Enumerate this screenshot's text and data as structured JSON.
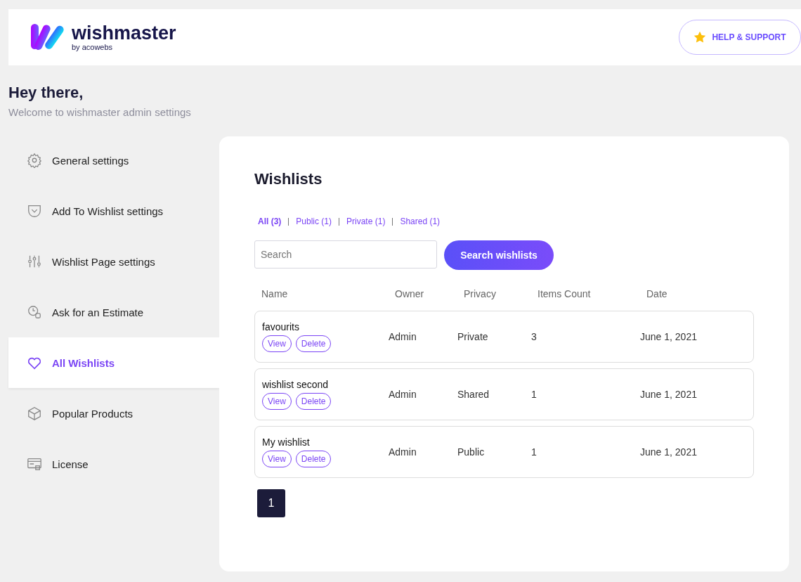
{
  "header": {
    "brand": "wishmaster",
    "byline": "by acowebs",
    "help_button": "HELP & SUPPORT"
  },
  "greeting": {
    "title": "Hey there,",
    "subtitle": "Welcome to wishmaster admin settings"
  },
  "sidebar": {
    "items": [
      {
        "label": "General settings",
        "kind": "gear",
        "selected": false
      },
      {
        "label": "Add To Wishlist settings",
        "kind": "pocket",
        "selected": false
      },
      {
        "label": "Wishlist Page settings",
        "kind": "sliders",
        "selected": false
      },
      {
        "label": "Ask for an Estimate",
        "kind": "estimate",
        "selected": false
      },
      {
        "label": "All Wishlists",
        "kind": "heart",
        "selected": true
      },
      {
        "label": "Popular Products",
        "kind": "box",
        "selected": false
      },
      {
        "label": "License",
        "kind": "license",
        "selected": false
      }
    ]
  },
  "main": {
    "title": "Wishlists",
    "filters": [
      {
        "label": "All (3)",
        "selected": true
      },
      {
        "label": "Public (1)",
        "selected": false
      },
      {
        "label": "Private (1)",
        "selected": false
      },
      {
        "label": "Shared (1)",
        "selected": false
      }
    ],
    "search": {
      "placeholder": "Search",
      "button": "Search wishlists"
    },
    "table": {
      "columns": [
        "Name",
        "Owner",
        "Privacy",
        "Items Count",
        "Date"
      ],
      "rows": [
        {
          "name": "favourits",
          "actions": [
            "View",
            "Delete"
          ],
          "owner": "Admin",
          "privacy": "Private",
          "items_count": "3",
          "date": "June 1, 2021"
        },
        {
          "name": "wishlist second",
          "actions": [
            "View",
            "Delete"
          ],
          "owner": "Admin",
          "privacy": "Shared",
          "items_count": "1",
          "date": "June 1, 2021"
        },
        {
          "name": "My wishlist",
          "actions": [
            "View",
            "Delete"
          ],
          "owner": "Admin",
          "privacy": "Public",
          "items_count": "1",
          "date": "June 1, 2021"
        }
      ]
    },
    "pages": [
      {
        "label": "1",
        "selected": true
      }
    ]
  }
}
